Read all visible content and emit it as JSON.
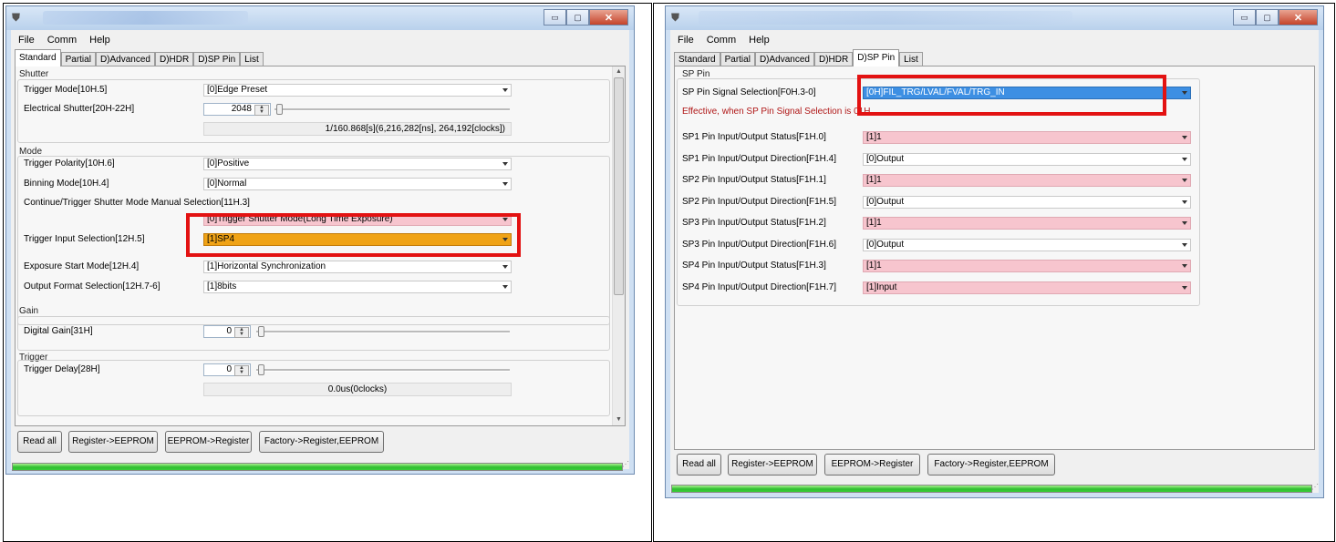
{
  "colors": {
    "highlight": "#e31212",
    "pink_field": "#f7c5ce",
    "orange_field": "#f0a316",
    "selected_field": "#3d8fe3",
    "progress": "#2fbf2f"
  },
  "menu": [
    "File",
    "Comm",
    "Help"
  ],
  "tabs": [
    "Standard",
    "Partial",
    "D)Advanced",
    "D)HDR",
    "D)SP Pin",
    "List"
  ],
  "buttons": {
    "read_all": "Read all",
    "reg_to_eeprom": "Register->EEPROM",
    "eeprom_to_reg": "EEPROM->Register",
    "factory": "Factory->Register,EEPROM"
  },
  "left": {
    "active_tab": "Standard",
    "shutter": {
      "title": "Shutter",
      "trigger_mode_label": "Trigger Mode[10H.5]",
      "trigger_mode_value": "[0]Edge Preset",
      "electrical_shutter_label": "Electrical Shutter[20H-22H]",
      "electrical_shutter_value": "2048",
      "electrical_shutter_readout": "1/160.868[s](6,216,282[ns], 264,192[clocks])"
    },
    "mode": {
      "title": "Mode",
      "trigger_polarity_label": "Trigger Polarity[10H.6]",
      "trigger_polarity_value": "[0]Positive",
      "binning_label": "Binning Mode[10H.4]",
      "binning_value": "[0]Normal",
      "continue_label": "Continue/Trigger Shutter Mode Manual Selection[11H.3]",
      "continue_value": "[0]Trigger Shutter Mode(Long Time Exposure)",
      "trigger_input_label": "Trigger Input Selection[12H.5]",
      "trigger_input_value": "[1]SP4",
      "exposure_start_label": "Exposure Start Mode[12H.4]",
      "exposure_start_value": "[1]Horizontal Synchronization",
      "output_format_label": "Output Format Selection[12H.7-6]",
      "output_format_value": "[1]8bits"
    },
    "gain": {
      "title": "Gain",
      "digital_gain_label": "Digital Gain[31H]",
      "digital_gain_value": "0"
    },
    "trigger": {
      "title": "Trigger",
      "delay_label": "Trigger Delay[28H]",
      "delay_value": "0",
      "delay_readout": "0.0us(0clocks)"
    },
    "progress": 1.0
  },
  "right": {
    "active_tab": "D)SP Pin",
    "group_title": "SP Pin",
    "signal_label": "SP Pin Signal Selection[F0H.3-0]",
    "signal_value": "[0H]FIL_TRG/LVAL/FVAL/TRG_IN",
    "warning": "Effective, when SP Pin Signal Selection is 01H.",
    "rows": [
      {
        "label": "SP1 Pin Input/Output Status[F1H.0]",
        "value": "[1]1",
        "style": "pink"
      },
      {
        "label": "SP1 Pin Input/Output Direction[F1H.4]",
        "value": "[0]Output",
        "style": "white"
      },
      {
        "label": "SP2 Pin Input/Output Status[F1H.1]",
        "value": "[1]1",
        "style": "pink"
      },
      {
        "label": "SP2 Pin Input/Output Direction[F1H.5]",
        "value": "[0]Output",
        "style": "white"
      },
      {
        "label": "SP3 Pin Input/Output Status[F1H.2]",
        "value": "[1]1",
        "style": "pink"
      },
      {
        "label": "SP3 Pin Input/Output Direction[F1H.6]",
        "value": "[0]Output",
        "style": "white"
      },
      {
        "label": "SP4 Pin Input/Output Status[F1H.3]",
        "value": "[1]1",
        "style": "pink"
      },
      {
        "label": "SP4 Pin Input/Output Direction[F1H.7]",
        "value": "[1]Input",
        "style": "pink"
      }
    ],
    "progress": 1.0
  }
}
